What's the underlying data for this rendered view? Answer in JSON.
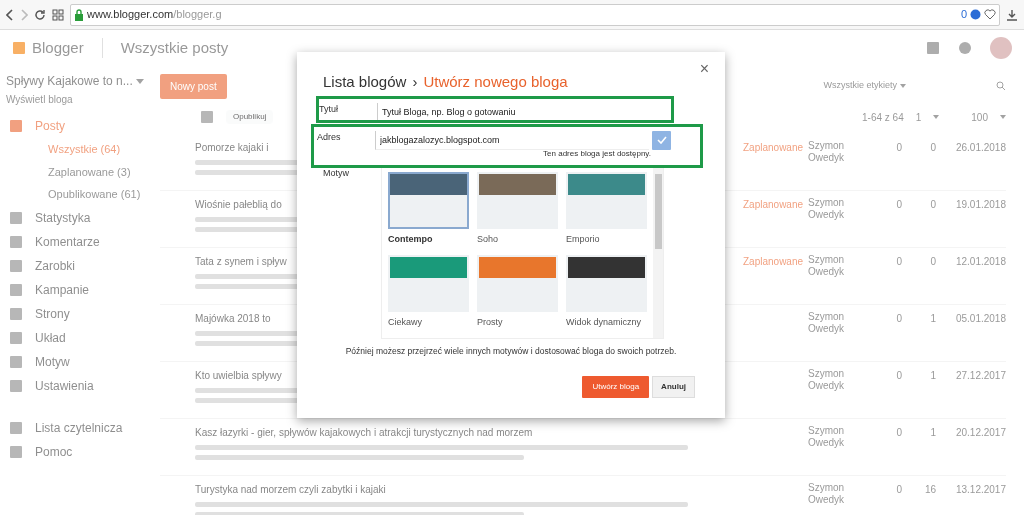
{
  "browser": {
    "url_domain": "www.blogger.com",
    "url_path": "/blogger.g",
    "badge": "0"
  },
  "header": {
    "brand": "Blogger",
    "section": "Wszystkie posty"
  },
  "sidebar": {
    "blog_name": "Spływy Kajakowe to n...",
    "view_link": "Wyświetl bloga",
    "items": [
      {
        "label": "Posty",
        "selected": true,
        "children": [
          {
            "label": "Wszystkie (64)",
            "selected": true
          },
          {
            "label": "Zaplanowane (3)",
            "selected": false
          },
          {
            "label": "Opublikowane (61)",
            "selected": false
          }
        ]
      },
      {
        "label": "Statystyka",
        "selected": false
      },
      {
        "label": "Komentarze",
        "selected": false
      },
      {
        "label": "Zarobki",
        "selected": false
      },
      {
        "label": "Kampanie",
        "selected": false
      },
      {
        "label": "Strony",
        "selected": false
      },
      {
        "label": "Układ",
        "selected": false
      },
      {
        "label": "Motyw",
        "selected": false
      },
      {
        "label": "Ustawienia",
        "selected": false
      }
    ],
    "footer_items": [
      {
        "label": "Lista czytelnicza",
        "selected": false
      },
      {
        "label": "Pomoc",
        "selected": false
      }
    ]
  },
  "toolbar": {
    "new_post": "Nowy post",
    "publish": "Opublikuj",
    "labels_filter": "Wszystkie etykiety",
    "range": "1-64 z 64",
    "page": "1",
    "per_page": "100"
  },
  "posts": [
    {
      "title": "Pomorze kajaki i",
      "status": "Zaplanowane",
      "author": "Szymon Owedyk",
      "comments": "0",
      "views": "0",
      "date": "26.01.2018"
    },
    {
      "title": "Wiośnie pałeblią do",
      "status": "Zaplanowane",
      "author": "Szymon Owedyk",
      "comments": "0",
      "views": "0",
      "date": "19.01.2018"
    },
    {
      "title": "Tata z synem i spływ",
      "status": "Zaplanowane",
      "author": "Szymon Owedyk",
      "comments": "0",
      "views": "0",
      "date": "12.01.2018"
    },
    {
      "title": "Majówka 2018 to",
      "author": "Szymon Owedyk",
      "comments": "0",
      "views": "1",
      "date": "05.01.2018"
    },
    {
      "title": "Kto uwielbia spływy",
      "author": "Szymon Owedyk",
      "comments": "0",
      "views": "1",
      "date": "27.12.2017"
    },
    {
      "title": "Kasz łazyrki - gier, spływów kajakowych i atrakcji turystycznych nad morzem",
      "author": "Szymon Owedyk",
      "comments": "0",
      "views": "1",
      "date": "20.12.2017"
    },
    {
      "title": "Turystyka nad morzem czyli zabytki i kajaki",
      "author": "Szymon Owedyk",
      "comments": "0",
      "views": "16",
      "date": "13.12.2017"
    }
  ],
  "dialog": {
    "crumb": "Lista blogów",
    "separator": "›",
    "title": "Utwórz nowego bloga",
    "close": "×",
    "title_label": "Tytuł",
    "title_value": "Tytuł Bloga, np. Blog o gotowaniu",
    "address_label": "Adres",
    "address_value": "jakblogazalozyc.blogspot.com",
    "address_ok": true,
    "address_status": "Ten adres bloga jest dostępny.",
    "theme_label": "Motyw",
    "themes": [
      {
        "name": "Contempo",
        "selected": true
      },
      {
        "name": "Soho",
        "selected": false
      },
      {
        "name": "Emporio",
        "selected": false
      },
      {
        "name": "Ciekawy",
        "selected": false
      },
      {
        "name": "Prosty",
        "selected": false
      },
      {
        "name": "Widok dynamiczny",
        "selected": false
      }
    ],
    "note": "Później możesz przejrzeć wiele innych motywów i dostosować bloga do swoich potrzeb.",
    "create": "Utwórz bloga",
    "cancel": "Anuluj"
  }
}
